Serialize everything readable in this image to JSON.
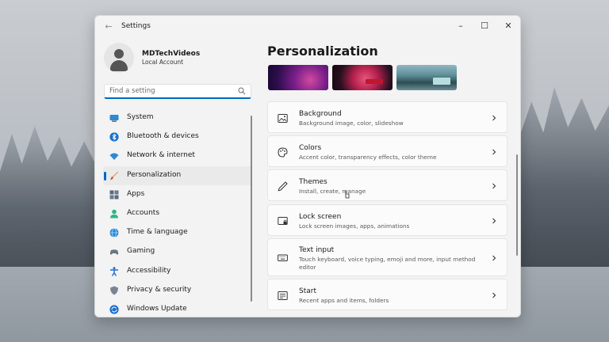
{
  "window": {
    "title": "Settings",
    "back_glyph": "←",
    "minimize_glyph": "–",
    "maximize_glyph": "☐",
    "close_glyph": "✕"
  },
  "profile": {
    "name": "MDTechVideos",
    "account_type": "Local Account"
  },
  "search": {
    "placeholder": "Find a setting"
  },
  "nav": {
    "items": [
      {
        "label": "System",
        "icon": "system-icon"
      },
      {
        "label": "Bluetooth & devices",
        "icon": "bluetooth-icon"
      },
      {
        "label": "Network & internet",
        "icon": "wifi-icon"
      },
      {
        "label": "Personalization",
        "icon": "brush-icon",
        "active": true
      },
      {
        "label": "Apps",
        "icon": "apps-icon"
      },
      {
        "label": "Accounts",
        "icon": "person-icon"
      },
      {
        "label": "Time & language",
        "icon": "globe-clock-icon"
      },
      {
        "label": "Gaming",
        "icon": "gamepad-icon"
      },
      {
        "label": "Accessibility",
        "icon": "accessibility-icon"
      },
      {
        "label": "Privacy & security",
        "icon": "shield-icon"
      },
      {
        "label": "Windows Update",
        "icon": "update-icon"
      }
    ]
  },
  "main": {
    "title": "Personalization",
    "cards": [
      {
        "title": "Background",
        "desc": "Background image, color, slideshow",
        "icon": "image-icon"
      },
      {
        "title": "Colors",
        "desc": "Accent color, transparency effects, color theme",
        "icon": "palette-icon"
      },
      {
        "title": "Themes",
        "desc": "Install, create, manage",
        "icon": "pen-icon"
      },
      {
        "title": "Lock screen",
        "desc": "Lock screen images, apps, animations",
        "icon": "lock-screen-icon"
      },
      {
        "title": "Text input",
        "desc": "Touch keyboard, voice typing, emoji and more, input method editor",
        "icon": "keyboard-icon"
      },
      {
        "title": "Start",
        "desc": "Recent apps and items, folders",
        "icon": "start-icon"
      }
    ]
  },
  "colors": {
    "accent": "#0067c0",
    "window_bg": "#f3f3f3",
    "card_bg": "#fbfbfb"
  }
}
